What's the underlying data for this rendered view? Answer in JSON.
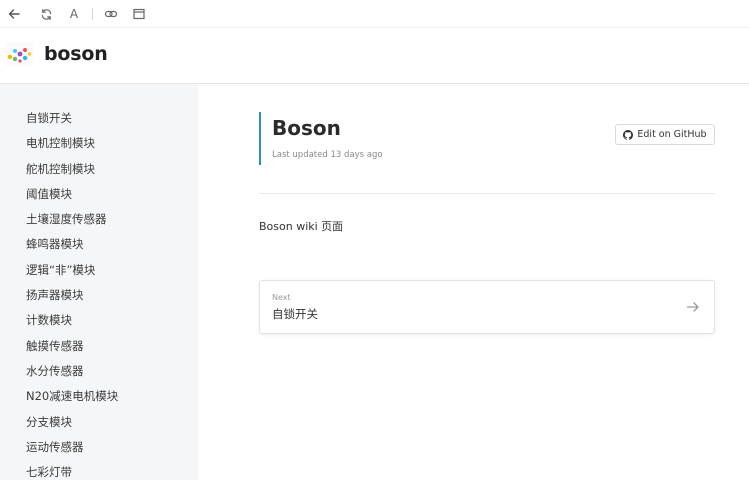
{
  "toolbar": {
    "icons": [
      "back-arrow-icon",
      "refresh-icon",
      "font-a-icon",
      "link-icon",
      "window-icon"
    ],
    "font_label": "A"
  },
  "header": {
    "site_title": "boson"
  },
  "sidebar": {
    "items": [
      {
        "label": "自锁开关"
      },
      {
        "label": "电机控制模块"
      },
      {
        "label": "舵机控制模块"
      },
      {
        "label": "阈值模块"
      },
      {
        "label": "土壤湿度传感器"
      },
      {
        "label": "蜂鸣器模块"
      },
      {
        "label": "逻辑“非”模块"
      },
      {
        "label": "扬声器模块"
      },
      {
        "label": "计数模块"
      },
      {
        "label": "触摸传感器"
      },
      {
        "label": "水分传感器"
      },
      {
        "label": "N20减速电机模块"
      },
      {
        "label": "分支模块"
      },
      {
        "label": "运动传感器"
      },
      {
        "label": "七彩灯带"
      }
    ]
  },
  "main": {
    "title": "Boson",
    "last_updated": "Last updated 13 days ago",
    "edit_button": "Edit on GitHub",
    "body_text": "Boson wiki 页面",
    "next": {
      "label": "Next",
      "title": "自锁开关"
    }
  },
  "colors": {
    "accent": "#2e8fbf",
    "sidebar_bg": "#f5f6f7"
  }
}
